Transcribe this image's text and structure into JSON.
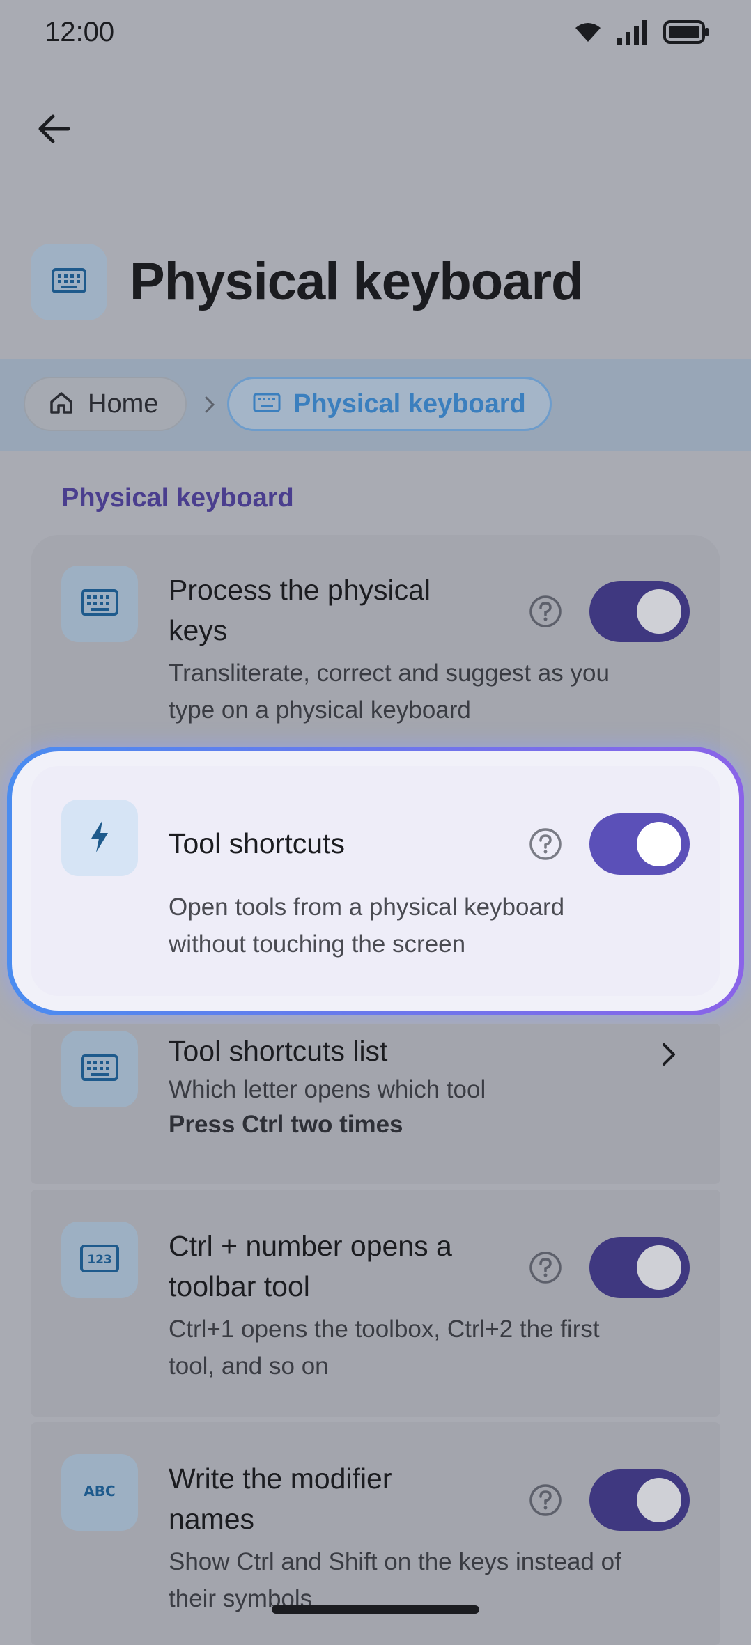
{
  "status_bar": {
    "time": "12:00"
  },
  "header": {
    "title": "Physical keyboard"
  },
  "breadcrumb": {
    "home": "Home",
    "current": "Physical keyboard"
  },
  "section": {
    "title": "Physical keyboard"
  },
  "rows": [
    {
      "title_line1": "Process the physical",
      "title_line2": "keys",
      "desc_line1": "Transliterate, correct and suggest as you",
      "desc_line2": "type on a physical keyboard",
      "toggle_on": true
    },
    {
      "title": "Tool shortcuts",
      "desc_line1": "Open tools from a physical keyboard",
      "desc_line2": "without touching the screen",
      "toggle_on": true
    },
    {
      "title": "Tool shortcuts list",
      "desc": "Which letter opens which tool",
      "note": "Press Ctrl two times"
    },
    {
      "title_line1": "Ctrl + number opens a",
      "title_line2": "toolbar tool",
      "desc_line1": "Ctrl+1 opens the toolbox, Ctrl+2 the first",
      "desc_line2": "tool, and so on",
      "toggle_on": true
    },
    {
      "title_line1": "Write the modifier",
      "title_line2": "names",
      "desc_line1": "Show Ctrl and Shift on the keys instead of",
      "desc_line2": "their symbols",
      "toggle_on": true
    }
  ],
  "icons": {
    "back": "arrow-left-icon",
    "keyboard": "keyboard-icon",
    "home": "home-icon",
    "bolt": "lightning-bolt-icon",
    "numbers": "123-icon",
    "abc": "abc-icon",
    "help": "help-circle-icon",
    "chevron": "chevron-right-icon"
  },
  "colors": {
    "accent": "#5b50b8",
    "toggle_dim": "#3f3880",
    "section_title": "#4a3e8e",
    "breadcrumb_active": "#3b7fbe",
    "highlight_start": "#4a8cf0",
    "highlight_end": "#8a63e8"
  }
}
